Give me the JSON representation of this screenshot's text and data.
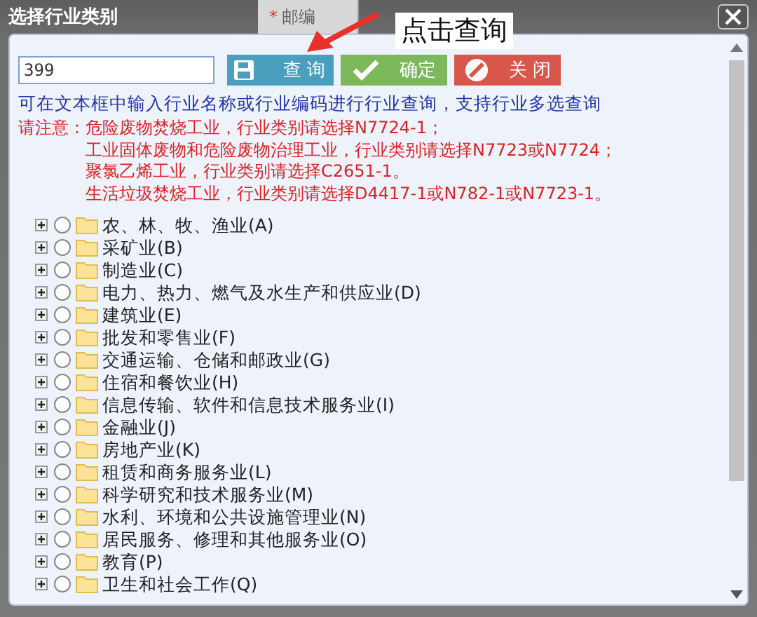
{
  "window": {
    "title": "选择行业类别",
    "background_field": {
      "required_mark": "*",
      "label": "邮编"
    }
  },
  "annotation": {
    "text": "点击查询"
  },
  "search": {
    "value": "399"
  },
  "buttons": [
    {
      "kind": "search",
      "label": "查 询"
    },
    {
      "kind": "confirm",
      "label": "确定"
    },
    {
      "kind": "close",
      "label": "关 闭"
    }
  ],
  "hint": "可在文本框中输入行业名称或行业编码进行行业查询，支持行业多选查询",
  "notice": {
    "prefix": "请注意：",
    "lines": [
      "危险废物焚烧工业，行业类别请选择N7724-1；",
      "工业固体废物和危险废物治理工业，行业类别请选择N7723或N7724；",
      "聚氯乙烯工业，行业类别请选择C2651-1。",
      "生活垃圾焚烧工业，行业类别请选择D4417-1或N782-1或N7723-1。"
    ]
  },
  "tree": [
    {
      "label": "农、林、牧、渔业(A)",
      "expanded": false,
      "selected": false
    },
    {
      "label": "采矿业(B)",
      "expanded": false,
      "selected": false
    },
    {
      "label": "制造业(C)",
      "expanded": false,
      "selected": false
    },
    {
      "label": "电力、热力、燃气及水生产和供应业(D)",
      "expanded": false,
      "selected": false
    },
    {
      "label": "建筑业(E)",
      "expanded": false,
      "selected": false
    },
    {
      "label": "批发和零售业(F)",
      "expanded": false,
      "selected": false
    },
    {
      "label": "交通运输、仓储和邮政业(G)",
      "expanded": false,
      "selected": false
    },
    {
      "label": "住宿和餐饮业(H)",
      "expanded": false,
      "selected": false
    },
    {
      "label": "信息传输、软件和信息技术服务业(I)",
      "expanded": false,
      "selected": false
    },
    {
      "label": "金融业(J)",
      "expanded": false,
      "selected": false
    },
    {
      "label": "房地产业(K)",
      "expanded": false,
      "selected": false
    },
    {
      "label": "租赁和商务服务业(L)",
      "expanded": false,
      "selected": false
    },
    {
      "label": "科学研究和技术服务业(M)",
      "expanded": false,
      "selected": false
    },
    {
      "label": "水利、环境和公共设施管理业(N)",
      "expanded": false,
      "selected": false
    },
    {
      "label": "居民服务、修理和其他服务业(O)",
      "expanded": false,
      "selected": false
    },
    {
      "label": "教育(P)",
      "expanded": false,
      "selected": false
    },
    {
      "label": "卫生和社会工作(Q)",
      "expanded": false,
      "selected": false
    }
  ]
}
